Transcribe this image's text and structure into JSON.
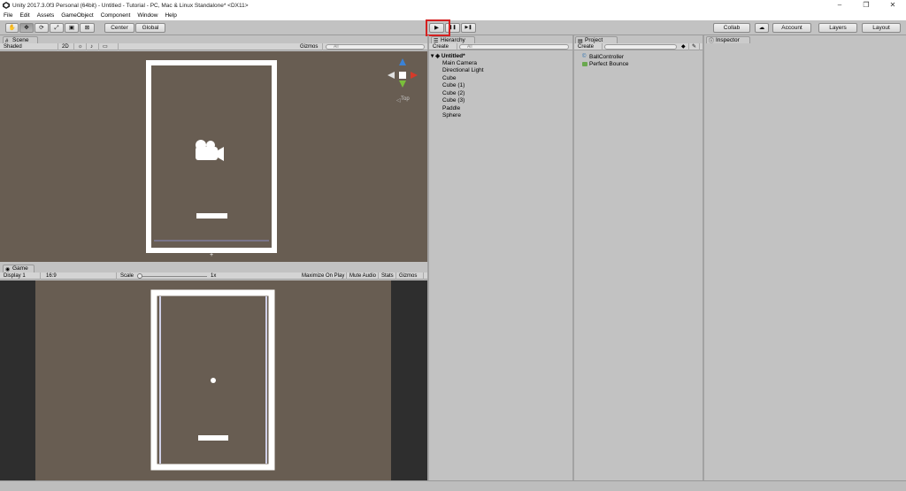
{
  "window": {
    "title": "Unity 2017.3.0f3 Personal (64bit) - Untitled - Tutorial - PC, Mac & Linux Standalone* <DX11>",
    "minimize": "–",
    "restore": "❐",
    "close": "✕"
  },
  "menu": [
    "File",
    "Edit",
    "Assets",
    "GameObject",
    "Component",
    "Window",
    "Help"
  ],
  "toolbar": {
    "pivot": "Center",
    "space": "Global",
    "collab": "Collab",
    "account": "Account",
    "layers": "Layers",
    "layout": "Layout",
    "play": "▶",
    "pause": "❚❚",
    "step": "▶❚"
  },
  "scene": {
    "tab": "Scene",
    "shading": "Shaded",
    "mode2d": "2D",
    "gizmos": "Gizmos",
    "search_placeholder": "All",
    "orientation": "Top"
  },
  "game": {
    "tab": "Game",
    "display": "Display 1",
    "aspect": "16:9",
    "scale_label": "Scale",
    "scale_value": "1x",
    "maximize": "Maximize On Play",
    "mute": "Mute Audio",
    "stats": "Stats",
    "gizmos": "Gizmos"
  },
  "hierarchy": {
    "tab": "Hierarchy",
    "create": "Create",
    "search_placeholder": "All",
    "scene_name": "Untitled*",
    "items": [
      "Main Camera",
      "Directional Light",
      "Cube",
      "Cube (1)",
      "Cube (2)",
      "Cube (3)",
      "Paddle",
      "Sphere"
    ]
  },
  "project": {
    "tab": "Project",
    "create": "Create",
    "items": [
      "BallController",
      "Perfect Bounce"
    ]
  },
  "inspector": {
    "tab": "Inspector"
  },
  "colors": {
    "view_bg": "#685d52",
    "accent_red": "#d42020"
  }
}
